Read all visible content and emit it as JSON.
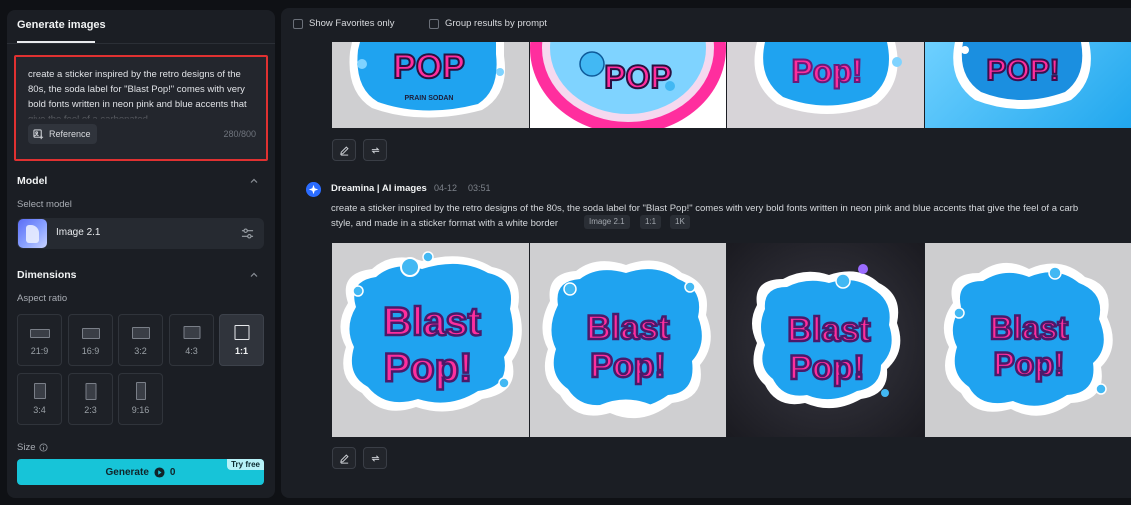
{
  "left_panel": {
    "tab_title": "Generate images",
    "prompt": {
      "text": "create a sticker inspired by the retro designs of the 80s, the soda label for \"Blast Pop!\" comes with very bold fonts written in neon pink and blue accents that give the feel of a carbonated",
      "reference_label": "Reference",
      "counter": "280/800"
    },
    "model": {
      "section_label": "Model",
      "select_label": "Select model",
      "name": "Image 2.1"
    },
    "dimensions": {
      "section_label": "Dimensions",
      "aspect_label": "Aspect ratio",
      "ratios": [
        "21:9",
        "16:9",
        "3:2",
        "4:3",
        "1:1",
        "3:4",
        "2:3",
        "9:16"
      ],
      "selected": "1:1",
      "size_label": "Size"
    },
    "generate": {
      "label": "Generate",
      "cost": "0",
      "badge": "Try free"
    }
  },
  "filters": {
    "favorites_label": "Show Favorites only",
    "group_label": "Group results by prompt"
  },
  "generation": {
    "author": "Dreamina | AI images",
    "date": "04-12",
    "time": "03:51",
    "prompt_line1": "create a sticker inspired by the retro designs of the 80s, the soda label for \"Blast Pop!\" comes with very bold fonts written in neon pink and blue accents that give the feel of a carb",
    "prompt_line2": "style, and made in a sticker format with a white border",
    "chips": [
      "Image 2.1",
      "1:1",
      "1K"
    ]
  },
  "top_images": {
    "labels": [
      "POP",
      "PRAIN SODAN",
      "POP",
      "Pop!",
      "POP!"
    ]
  },
  "bottom_images": {
    "labels": [
      "Blast",
      "Pop!",
      "Blast",
      "Pop!",
      "Blast",
      "Pop!",
      "Blast",
      "Pop!"
    ]
  },
  "colors": {
    "accent": "#17c4d8",
    "highlight_border": "#e03131",
    "sticker_pink": "#ff2e9e",
    "sticker_blue": "#1fa3f0"
  },
  "icons": [
    "reference-icon",
    "chevron-up-icon",
    "settings-sliders-icon",
    "info-icon",
    "coin-icon",
    "edit-icon",
    "regenerate-icon",
    "dreamina-logo-icon"
  ]
}
